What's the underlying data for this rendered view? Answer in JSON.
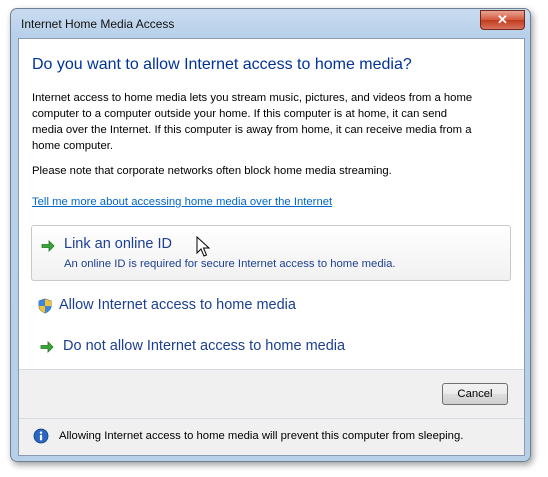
{
  "window": {
    "title": "Internet Home Media Access",
    "close_label": "✕"
  },
  "content": {
    "main_instruction": "Do you want to allow Internet access to home media?",
    "body_lines": [
      "Internet access to home media lets you stream music, pictures, and videos from a home",
      "computer to a computer outside your home.  If this computer is at home, it can send",
      "media over the Internet.  If this computer is away from home, it can receive media from a",
      "home computer."
    ],
    "note": "Please note that corporate networks often block home media streaming.",
    "more_link": "Tell me more about accessing home media over the Internet"
  },
  "commands": [
    {
      "label": "Link an online ID",
      "description": "An online ID is required for secure Internet access to home media.",
      "icon": "green-arrow-icon"
    },
    {
      "label": "Allow Internet access to home media",
      "icon": "uac-shield-icon"
    },
    {
      "label": "Do not allow Internet access to home media",
      "icon": "green-arrow-icon"
    }
  ],
  "footer": {
    "cancel_label": "Cancel"
  },
  "info_bar": {
    "icon": "info-icon",
    "text": "Allowing Internet access to home media will prevent this computer from sleeping."
  },
  "colors": {
    "instruction_blue": "#003399",
    "command_blue": "#1c3f94",
    "link_blue": "#0066cc",
    "arrow_green": "#3aa53a"
  }
}
